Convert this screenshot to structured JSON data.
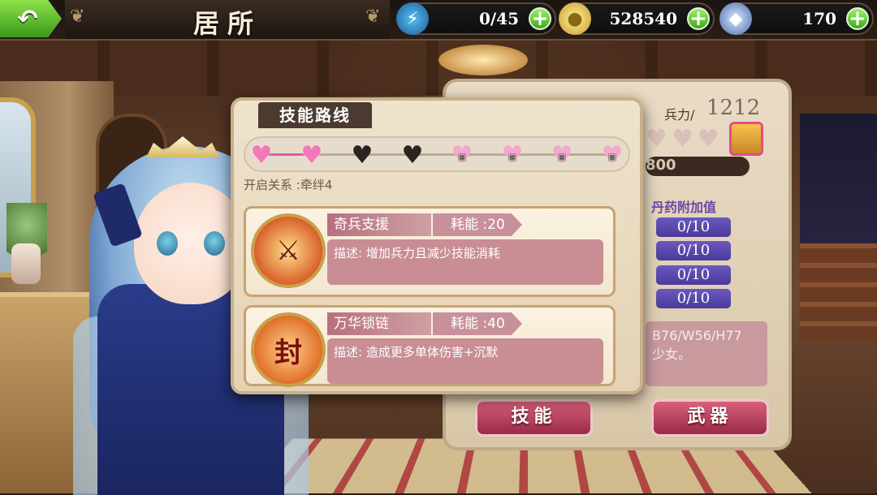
{
  "header": {
    "title": "居所",
    "back_icon": "back-arrow-icon"
  },
  "resources": {
    "energy": {
      "icon": "lightning-icon",
      "value": "0/45"
    },
    "gold": {
      "icon": "coin-icon",
      "value": "528540"
    },
    "crystal": {
      "icon": "crystal-icon",
      "value": "170"
    }
  },
  "stats_panel": {
    "power_label": "兵力/",
    "power_value": "1212",
    "progress_text": "800",
    "pill_section_title": "丹药附加值",
    "pills": [
      "0/10",
      "0/10",
      "0/10",
      "0/10"
    ],
    "measurements": "B76/W56/H77",
    "description": "少女。",
    "buttons": {
      "skill": "技能",
      "weapon": "武器"
    }
  },
  "skill_route": {
    "title": "技能路线",
    "nodes": [
      "unlocked",
      "unlocked",
      "unlocked-dark",
      "current",
      "locked",
      "locked",
      "locked",
      "locked"
    ],
    "unlock_text": "开启关系 :牵绊4"
  },
  "skills": [
    {
      "name": "奇兵支援",
      "cost": "耗能 :20",
      "description": "描述: 增加兵力且减少技能消耗",
      "icon": "soldier-icon"
    },
    {
      "name": "万华锁链",
      "cost": "耗能 :40",
      "description": "描述: 造成更多单体伤害+沉默",
      "icon": "chain-seal-icon",
      "icon_text": "封"
    }
  ],
  "colors": {
    "accent_green": "#3ea81e",
    "skill_pink": "#c88e94",
    "heart_pink": "#f07ab8"
  }
}
